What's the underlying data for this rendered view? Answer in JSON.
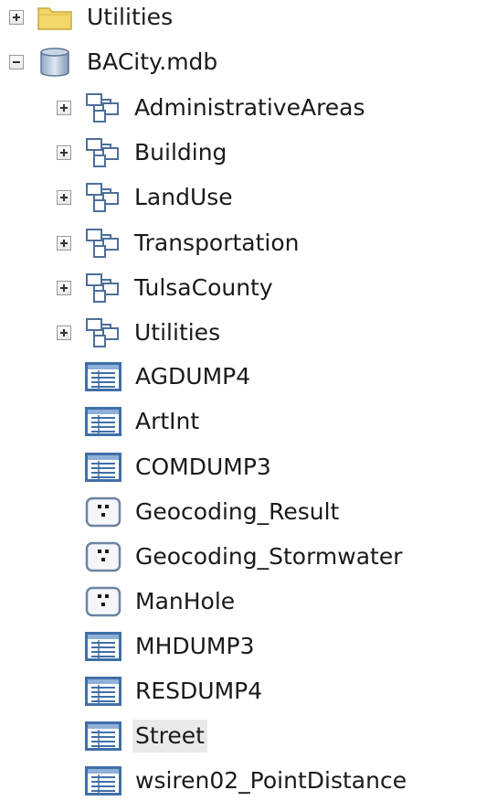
{
  "tree": {
    "items": [
      {
        "label": "Utilities",
        "icon": "folder-icon",
        "expander": "plus",
        "level": 0
      },
      {
        "label": "BACity.mdb",
        "icon": "database-icon",
        "expander": "minus",
        "level": 0
      },
      {
        "label": "AdministrativeAreas",
        "icon": "feature-dataset-icon",
        "expander": "plus",
        "level": 1
      },
      {
        "label": "Building",
        "icon": "feature-dataset-icon",
        "expander": "plus",
        "level": 1
      },
      {
        "label": "LandUse",
        "icon": "feature-dataset-icon",
        "expander": "plus",
        "level": 1
      },
      {
        "label": "Transportation",
        "icon": "feature-dataset-icon",
        "expander": "plus",
        "level": 1
      },
      {
        "label": "TulsaCounty",
        "icon": "feature-dataset-icon",
        "expander": "plus",
        "level": 1
      },
      {
        "label": "Utilities",
        "icon": "feature-dataset-icon",
        "expander": "plus",
        "level": 1
      },
      {
        "label": "AGDUMP4",
        "icon": "table-icon",
        "expander": "none",
        "level": 1
      },
      {
        "label": "ArtInt",
        "icon": "table-icon",
        "expander": "none",
        "level": 1
      },
      {
        "label": "COMDUMP3",
        "icon": "table-icon",
        "expander": "none",
        "level": 1
      },
      {
        "label": "Geocoding_Result",
        "icon": "point-feature-class-icon",
        "expander": "none",
        "level": 1
      },
      {
        "label": "Geocoding_Stormwater",
        "icon": "point-feature-class-icon",
        "expander": "none",
        "level": 1
      },
      {
        "label": "ManHole",
        "icon": "point-feature-class-icon",
        "expander": "none",
        "level": 1
      },
      {
        "label": "MHDUMP3",
        "icon": "table-icon",
        "expander": "none",
        "level": 1
      },
      {
        "label": "RESDUMP4",
        "icon": "table-icon",
        "expander": "none",
        "level": 1
      },
      {
        "label": "Street",
        "icon": "table-icon",
        "expander": "none",
        "level": 1,
        "selected": true
      },
      {
        "label": "wsiren02_PointDistance",
        "icon": "table-icon",
        "expander": "none",
        "level": 1
      }
    ]
  },
  "colors": {
    "selection_bg": "#e9e9e9",
    "folder_fill": "#f3d66a",
    "table_border": "#3f6fa8",
    "dataset_stroke": "#4d6f99"
  }
}
